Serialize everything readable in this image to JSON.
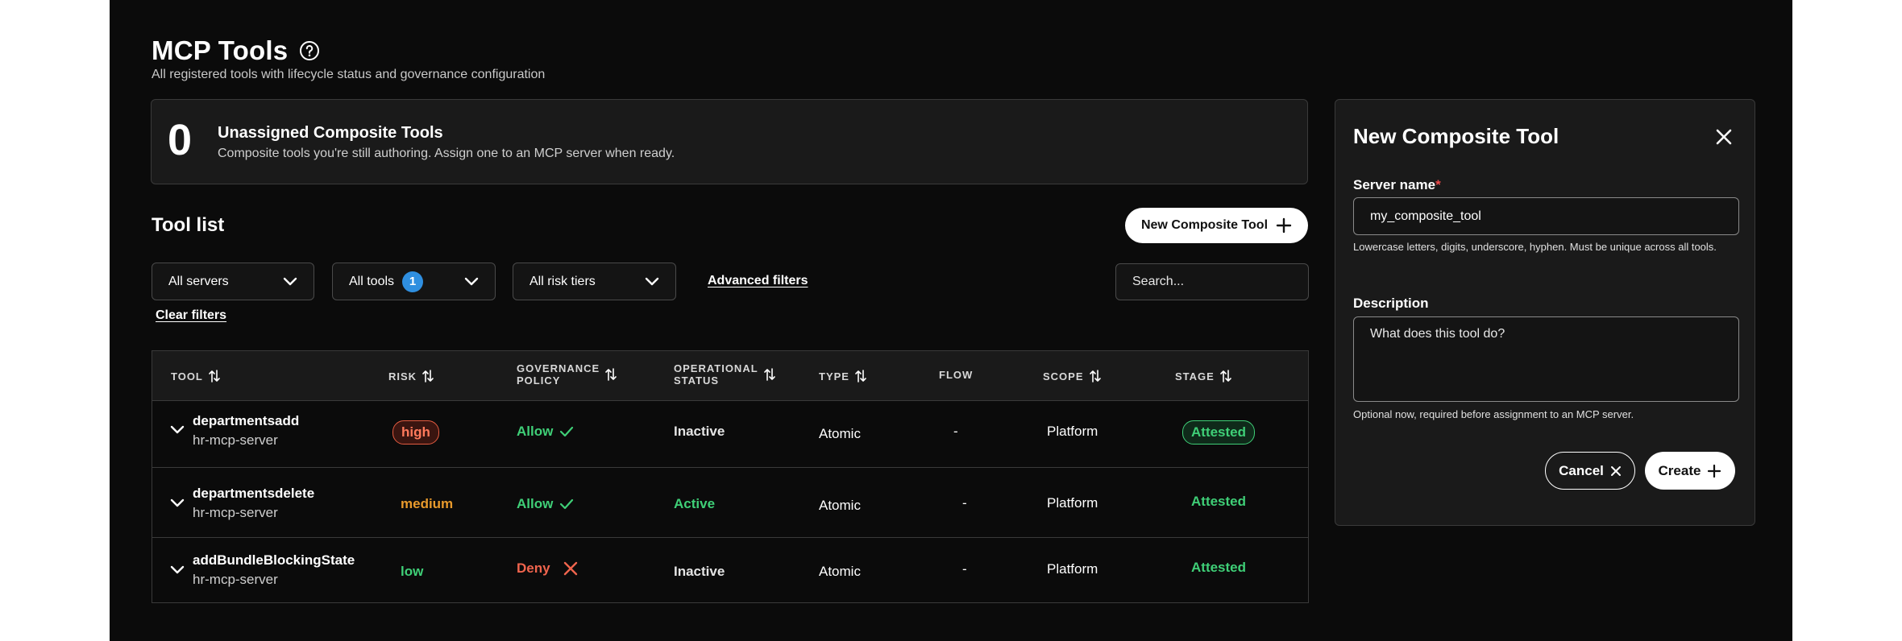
{
  "header": {
    "title": "MCP Tools",
    "subtitle": "All registered tools with lifecycle status and governance configuration"
  },
  "summary": {
    "count": "0",
    "title": "Unassigned Composite Tools",
    "description": "Composite tools you're still authoring. Assign one to an MCP server when ready."
  },
  "toolList": {
    "title": "Tool list",
    "new_button_label": "New Composite Tool"
  },
  "filters": {
    "servers": "All servers",
    "tools": "All tools",
    "tools_badge": "1",
    "risk": "All risk tiers",
    "advanced": "Advanced filters",
    "clear": "Clear filters",
    "search_placeholder": "Search..."
  },
  "table": {
    "columns": {
      "tool": "TOOL",
      "risk": "RISK",
      "governance_1": "GOVERNANCE",
      "governance_2": "POLICY",
      "operational_1": "OPERATIONAL",
      "operational_2": "STATUS",
      "type": "TYPE",
      "flow": "FLOW",
      "scope": "SCOPE",
      "stage": "STAGE"
    },
    "rows": [
      {
        "name": "departmentsadd",
        "server": "hr-mcp-server",
        "risk": "high",
        "governance": "Allow",
        "status": "Inactive",
        "type": "Atomic",
        "flow": "-",
        "scope": "Platform",
        "stage": "Attested"
      },
      {
        "name": "departmentsdelete",
        "server": "hr-mcp-server",
        "risk": "medium",
        "governance": "Allow",
        "status": "Active",
        "type": "Atomic",
        "flow": "-",
        "scope": "Platform",
        "stage": "Attested"
      },
      {
        "name": "addBundleBlockingState",
        "server": "hr-mcp-server",
        "risk": "low",
        "governance": "Deny",
        "status": "Inactive",
        "type": "Atomic",
        "flow": "-",
        "scope": "Platform",
        "stage": "Attested"
      }
    ]
  },
  "panel": {
    "title": "New Composite Tool",
    "server_label": "Server name",
    "required_mark": "*",
    "server_value": "my_composite_tool",
    "server_help": "Lowercase letters, digits, underscore, hyphen. Must be unique across all tools.",
    "description_label": "Description",
    "description_placeholder": "What does this tool do?",
    "description_help": "Optional now, required before assignment to an MCP server.",
    "cancel_label": "Cancel",
    "create_label": "Create"
  },
  "colors": {
    "background": "#0b0b0b",
    "card": "#1a1a1a",
    "success": "#3fcf77",
    "danger": "#f0644d",
    "warning": "#e89a2c",
    "badge": "#2f8fe0"
  }
}
